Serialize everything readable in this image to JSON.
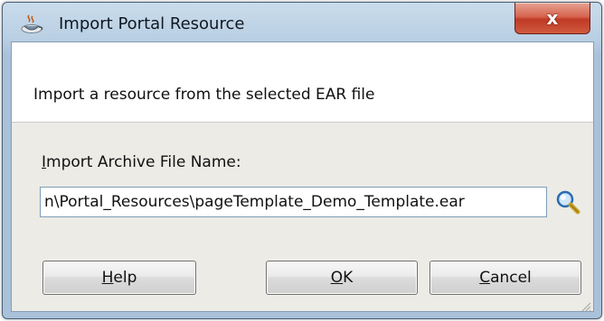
{
  "window": {
    "title": "Import Portal Resource",
    "title_icon": "java-cup-icon",
    "close_label": "x"
  },
  "header": {
    "description": "Import a resource from the selected EAR file"
  },
  "form": {
    "field_label_mnemonic": "I",
    "field_label_rest": "mport Archive File Name:",
    "file_value": "n\\Portal_Resources\\pageTemplate_Demo_Template.ear",
    "browse_icon": "magnifier-icon"
  },
  "buttons": {
    "help_mnemonic": "H",
    "help_rest": "elp",
    "ok_mnemonic": "O",
    "ok_rest": "K",
    "cancel_mnemonic": "C",
    "cancel_rest": "ancel"
  },
  "colors": {
    "titlebar": "#b9cfe3",
    "close": "#c03a25",
    "client": "#ecebe6"
  }
}
